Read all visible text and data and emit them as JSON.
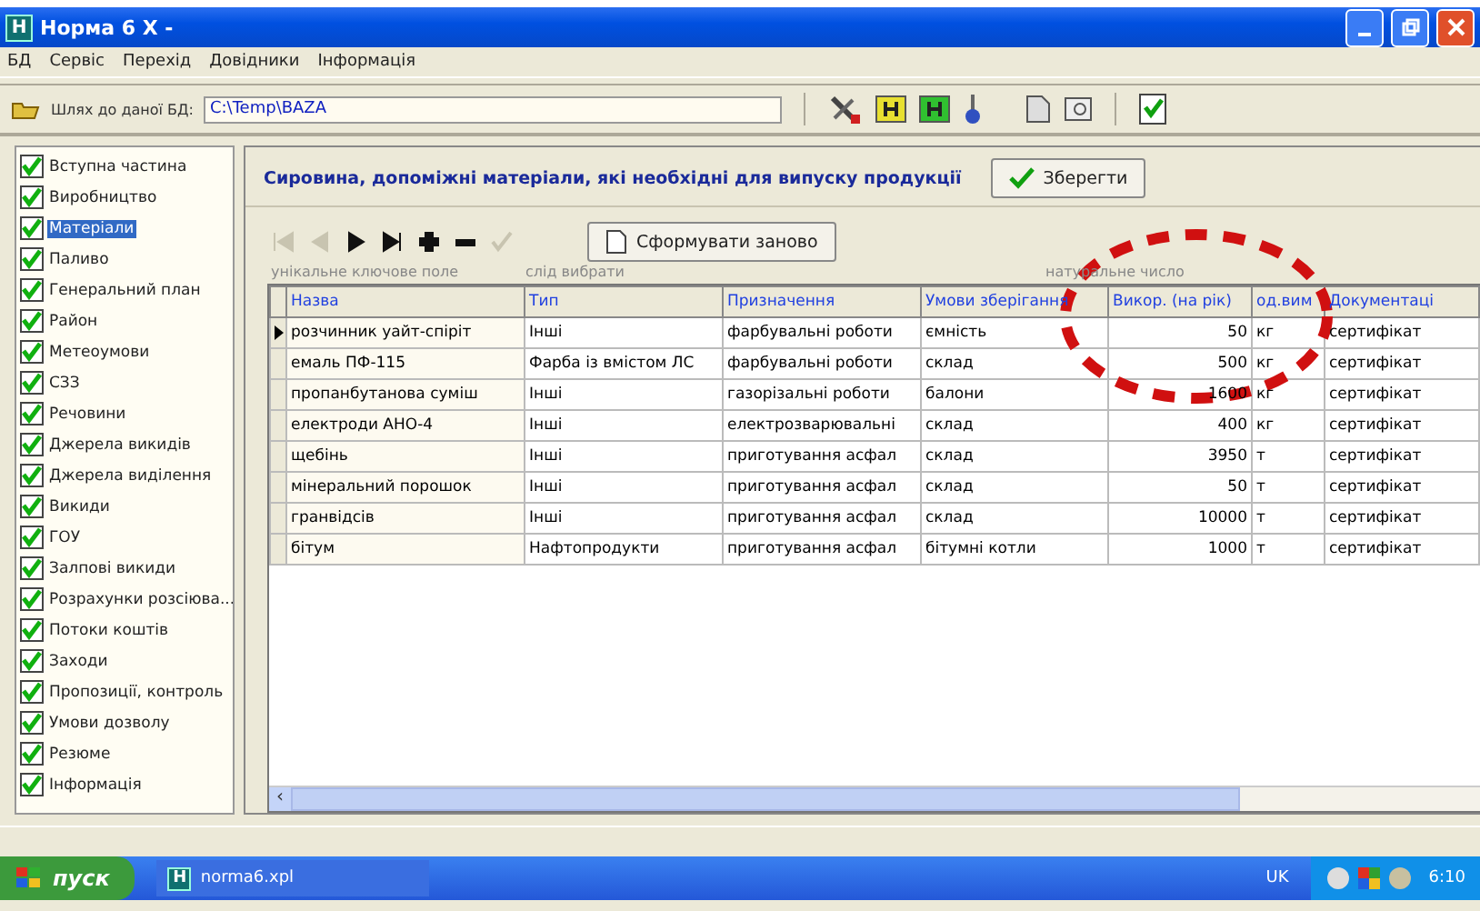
{
  "window": {
    "title": "Норма 6 X -",
    "icon_letter": "H"
  },
  "menu": [
    "БД",
    "Сервіс",
    "Перехід",
    "Довідники",
    "Інформація"
  ],
  "path_bar": {
    "label": "Шлях до даної БД:",
    "value": "C:\\Temp\\BAZA"
  },
  "sidebar": {
    "items": [
      {
        "label": "Вступна частина",
        "checked": true,
        "selected": false
      },
      {
        "label": "Виробництво",
        "checked": true,
        "selected": false
      },
      {
        "label": "Матеріали",
        "checked": true,
        "selected": true
      },
      {
        "label": "Паливо",
        "checked": true,
        "selected": false
      },
      {
        "label": "Генеральний план",
        "checked": true,
        "selected": false
      },
      {
        "label": "Район",
        "checked": true,
        "selected": false
      },
      {
        "label": "Метеоумови",
        "checked": true,
        "selected": false
      },
      {
        "label": "СЗЗ",
        "checked": true,
        "selected": false
      },
      {
        "label": "Речовини",
        "checked": true,
        "selected": false
      },
      {
        "label": "Джерела викидів",
        "checked": true,
        "selected": false
      },
      {
        "label": "Джерела виділення",
        "checked": true,
        "selected": false
      },
      {
        "label": "Викиди",
        "checked": true,
        "selected": false
      },
      {
        "label": "ГОУ",
        "checked": true,
        "selected": false
      },
      {
        "label": "Залпові викиди",
        "checked": true,
        "selected": false
      },
      {
        "label": "Розрахунки розсіюва...",
        "checked": true,
        "selected": false
      },
      {
        "label": "Потоки коштів",
        "checked": true,
        "selected": false
      },
      {
        "label": "Заходи",
        "checked": true,
        "selected": false
      },
      {
        "label": "Пропозиції, контроль",
        "checked": true,
        "selected": false
      },
      {
        "label": "Умови дозволу",
        "checked": true,
        "selected": false
      },
      {
        "label": "Резюме",
        "checked": true,
        "selected": false
      },
      {
        "label": "Інформація",
        "checked": true,
        "selected": false
      }
    ]
  },
  "panel": {
    "heading": "Сировина, допоміжні матеріали, які необхідні для випуску продукції",
    "save_button": "Зберегти",
    "rebuild_button": "Сформувати заново",
    "hints": [
      "унікальне ключове поле",
      "слід вибрати",
      "натуральне число"
    ],
    "nav_buttons": [
      {
        "kind": "first",
        "disabled": true
      },
      {
        "kind": "prior",
        "disabled": true
      },
      {
        "kind": "next",
        "disabled": false
      },
      {
        "kind": "last",
        "disabled": false
      },
      {
        "kind": "insert",
        "disabled": false
      },
      {
        "kind": "delete",
        "disabled": false
      },
      {
        "kind": "post",
        "disabled": true
      }
    ]
  },
  "table": {
    "columns": [
      "Назва",
      "Тип",
      "Призначення",
      "Умови зберігання",
      "Викор. (на рік)",
      "од.вим",
      "Документаці"
    ],
    "rows": [
      {
        "current": true,
        "cells": [
          "розчинник уайт-спіріт",
          "Інші",
          "фарбувальні роботи",
          "ємність",
          "50",
          "кг",
          "сертифікат"
        ]
      },
      {
        "current": false,
        "cells": [
          "емаль ПФ-115",
          "Фарба із вмістом ЛС",
          "фарбувальні роботи",
          "склад",
          "500",
          "кг",
          "сертифікат"
        ]
      },
      {
        "current": false,
        "cells": [
          "пропанбутанова суміш",
          "Інші",
          "газорізальні роботи",
          "балони",
          "1600",
          "кг",
          "сертифікат"
        ]
      },
      {
        "current": false,
        "cells": [
          "електроди АНО-4",
          "Інші",
          "електрозварювальні",
          "склад",
          "400",
          "кг",
          "сертифікат"
        ]
      },
      {
        "current": false,
        "cells": [
          "щебінь",
          "Інші",
          "приготування асфал",
          "склад",
          "3950",
          "т",
          "сертифікат"
        ]
      },
      {
        "current": false,
        "cells": [
          "мінеральний порошок",
          "Інші",
          "приготування асфал",
          "склад",
          "50",
          "т",
          "сертифікат"
        ]
      },
      {
        "current": false,
        "cells": [
          "гранвідсів",
          "Інші",
          "приготування асфал",
          "склад",
          "10000",
          "т",
          "сертифікат"
        ]
      },
      {
        "current": false,
        "cells": [
          "бітум",
          "Нафтопродукти",
          "приготування асфал",
          "бітумні котли",
          "1000",
          "т",
          "сертифікат"
        ]
      }
    ]
  },
  "scrollbar": {
    "left_arrow": "‹"
  },
  "taskbar": {
    "start": "пуск",
    "task_icon_letter": "H",
    "task": "norma6.xpl",
    "language": "UK",
    "clock": "6:10"
  }
}
